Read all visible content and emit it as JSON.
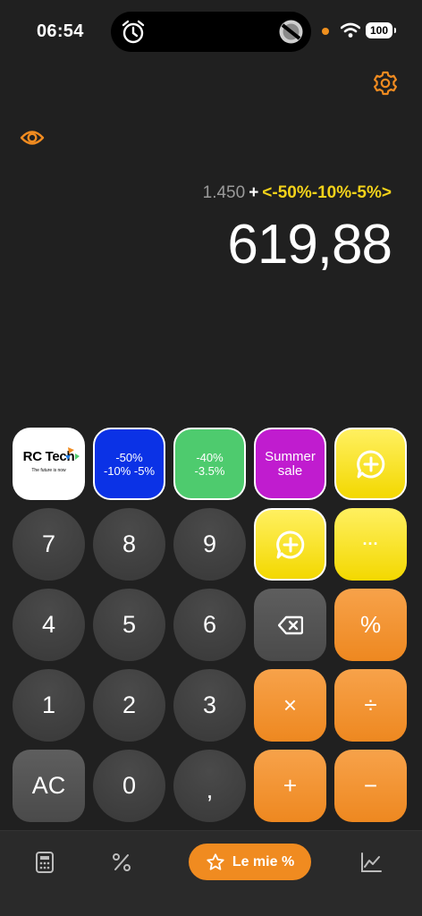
{
  "status": {
    "time": "06:54",
    "battery": "100"
  },
  "display": {
    "expression_number": "1.450",
    "expression_operator": "+",
    "expression_discount": "<-50%-10%-5%>",
    "result": "619,88"
  },
  "presets": {
    "logo_title": "RC Tech",
    "logo_tagline": "The future is now",
    "blue_line1": "-50%",
    "blue_line2": "-10% -5%",
    "green_line1": "-40%",
    "green_line2": "-3.5%",
    "purple_line1": "Summer",
    "purple_line2": "sale"
  },
  "keys": {
    "seven": "7",
    "eight": "8",
    "nine": "9",
    "four": "4",
    "five": "5",
    "six": "6",
    "one": "1",
    "two": "2",
    "three": "3",
    "ac": "AC",
    "zero": "0",
    "comma": ",",
    "more": "···",
    "percent": "%",
    "multiply": "×",
    "divide": "÷",
    "plus": "+",
    "minus": "−"
  },
  "tabbar": {
    "favorites_label": "Le mie %"
  },
  "colors": {
    "accent": "#f08b20",
    "discount_yellow": "#f3d21a",
    "background": "#202020"
  },
  "icons": [
    "alarm-icon",
    "camera-lens-icon",
    "wifi-icon",
    "gear-icon",
    "eye-icon",
    "add-comment-icon",
    "backspace-icon",
    "calculator-icon",
    "percent-icon",
    "star-icon",
    "chart-icon"
  ]
}
